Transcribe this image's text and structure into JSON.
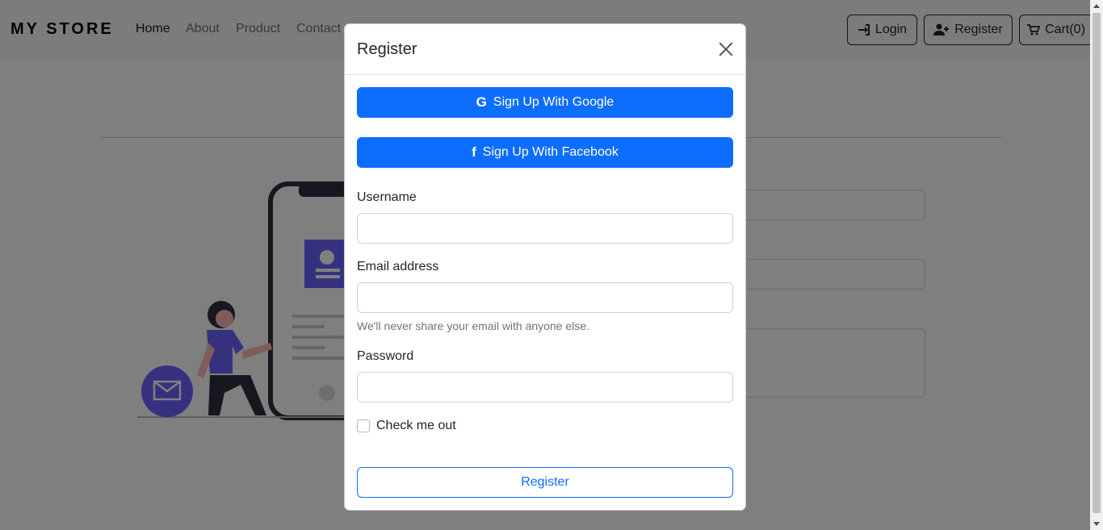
{
  "navbar": {
    "brand": "MY STORE",
    "links": [
      "Home",
      "About",
      "Product",
      "Contact"
    ],
    "login_label": "Login",
    "register_label": "Register",
    "cart_label": "Cart(0)"
  },
  "modal": {
    "title": "Register",
    "google_label": "Sign Up With Google",
    "facebook_label": "Sign Up With Facebook",
    "username_label": "Username",
    "email_label": "Email address",
    "email_help": "We'll never share your email with anyone else.",
    "password_label": "Password",
    "checkbox_label": "Check me out",
    "submit_label": "Register"
  },
  "colors": {
    "primary": "#0d6efd",
    "illustration_accent": "#6c63ff",
    "overlay": "rgba(0,0,0,0.5)"
  },
  "icons": {
    "login": "sign-in-icon",
    "register": "user-plus-icon",
    "cart": "shopping-cart-icon",
    "google": "google-icon",
    "facebook": "facebook-icon",
    "close": "close-icon"
  }
}
